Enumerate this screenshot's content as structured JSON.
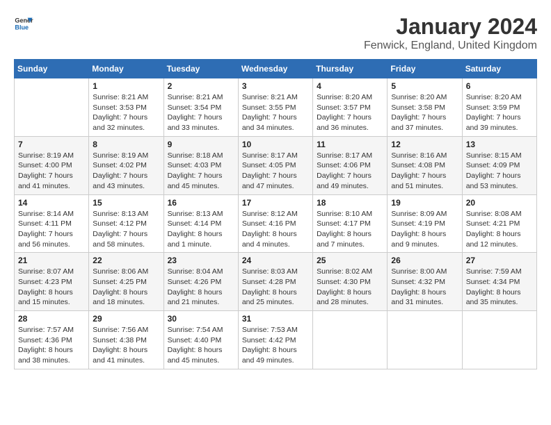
{
  "logo": {
    "line1": "General",
    "line2": "Blue"
  },
  "title": "January 2024",
  "subtitle": "Fenwick, England, United Kingdom",
  "weekdays": [
    "Sunday",
    "Monday",
    "Tuesday",
    "Wednesday",
    "Thursday",
    "Friday",
    "Saturday"
  ],
  "weeks": [
    [
      {
        "day": "",
        "info": ""
      },
      {
        "day": "1",
        "info": "Sunrise: 8:21 AM\nSunset: 3:53 PM\nDaylight: 7 hours\nand 32 minutes."
      },
      {
        "day": "2",
        "info": "Sunrise: 8:21 AM\nSunset: 3:54 PM\nDaylight: 7 hours\nand 33 minutes."
      },
      {
        "day": "3",
        "info": "Sunrise: 8:21 AM\nSunset: 3:55 PM\nDaylight: 7 hours\nand 34 minutes."
      },
      {
        "day": "4",
        "info": "Sunrise: 8:20 AM\nSunset: 3:57 PM\nDaylight: 7 hours\nand 36 minutes."
      },
      {
        "day": "5",
        "info": "Sunrise: 8:20 AM\nSunset: 3:58 PM\nDaylight: 7 hours\nand 37 minutes."
      },
      {
        "day": "6",
        "info": "Sunrise: 8:20 AM\nSunset: 3:59 PM\nDaylight: 7 hours\nand 39 minutes."
      }
    ],
    [
      {
        "day": "7",
        "info": ""
      },
      {
        "day": "8",
        "info": "Sunrise: 8:19 AM\nSunset: 4:02 PM\nDaylight: 7 hours\nand 43 minutes."
      },
      {
        "day": "9",
        "info": "Sunrise: 8:18 AM\nSunset: 4:03 PM\nDaylight: 7 hours\nand 45 minutes."
      },
      {
        "day": "10",
        "info": "Sunrise: 8:17 AM\nSunset: 4:05 PM\nDaylight: 7 hours\nand 47 minutes."
      },
      {
        "day": "11",
        "info": "Sunrise: 8:17 AM\nSunset: 4:06 PM\nDaylight: 7 hours\nand 49 minutes."
      },
      {
        "day": "12",
        "info": "Sunrise: 8:16 AM\nSunset: 4:08 PM\nDaylight: 7 hours\nand 51 minutes."
      },
      {
        "day": "13",
        "info": "Sunrise: 8:15 AM\nSunset: 4:09 PM\nDaylight: 7 hours\nand 53 minutes."
      }
    ],
    [
      {
        "day": "14",
        "info": ""
      },
      {
        "day": "15",
        "info": "Sunrise: 8:13 AM\nSunset: 4:12 PM\nDaylight: 7 hours\nand 58 minutes."
      },
      {
        "day": "16",
        "info": "Sunrise: 8:13 AM\nSunset: 4:14 PM\nDaylight: 8 hours\nand 1 minute."
      },
      {
        "day": "17",
        "info": "Sunrise: 8:12 AM\nSunset: 4:16 PM\nDaylight: 8 hours\nand 4 minutes."
      },
      {
        "day": "18",
        "info": "Sunrise: 8:10 AM\nSunset: 4:17 PM\nDaylight: 8 hours\nand 7 minutes."
      },
      {
        "day": "19",
        "info": "Sunrise: 8:09 AM\nSunset: 4:19 PM\nDaylight: 8 hours\nand 9 minutes."
      },
      {
        "day": "20",
        "info": "Sunrise: 8:08 AM\nSunset: 4:21 PM\nDaylight: 8 hours\nand 12 minutes."
      }
    ],
    [
      {
        "day": "21",
        "info": ""
      },
      {
        "day": "22",
        "info": "Sunrise: 8:06 AM\nSunset: 4:25 PM\nDaylight: 8 hours\nand 18 minutes."
      },
      {
        "day": "23",
        "info": "Sunrise: 8:04 AM\nSunset: 4:26 PM\nDaylight: 8 hours\nand 21 minutes."
      },
      {
        "day": "24",
        "info": "Sunrise: 8:03 AM\nSunset: 4:28 PM\nDaylight: 8 hours\nand 25 minutes."
      },
      {
        "day": "25",
        "info": "Sunrise: 8:02 AM\nSunset: 4:30 PM\nDaylight: 8 hours\nand 28 minutes."
      },
      {
        "day": "26",
        "info": "Sunrise: 8:00 AM\nSunset: 4:32 PM\nDaylight: 8 hours\nand 31 minutes."
      },
      {
        "day": "27",
        "info": "Sunrise: 7:59 AM\nSunset: 4:34 PM\nDaylight: 8 hours\nand 35 minutes."
      }
    ],
    [
      {
        "day": "28",
        "info": ""
      },
      {
        "day": "29",
        "info": "Sunrise: 7:56 AM\nSunset: 4:38 PM\nDaylight: 8 hours\nand 41 minutes."
      },
      {
        "day": "30",
        "info": "Sunrise: 7:54 AM\nSunset: 4:40 PM\nDaylight: 8 hours\nand 45 minutes."
      },
      {
        "day": "31",
        "info": "Sunrise: 7:53 AM\nSunset: 4:42 PM\nDaylight: 8 hours\nand 49 minutes."
      },
      {
        "day": "",
        "info": ""
      },
      {
        "day": "",
        "info": ""
      },
      {
        "day": "",
        "info": ""
      }
    ]
  ],
  "week1_sun_info": "Sunrise: 8:19 AM\nSunset: 4:00 PM\nDaylight: 7 hours\nand 41 minutes.",
  "week3_sun_info": "Sunrise: 8:14 AM\nSunset: 4:11 PM\nDaylight: 7 hours\nand 56 minutes.",
  "week4_sun_info": "Sunrise: 8:07 AM\nSunset: 4:23 PM\nDaylight: 8 hours\nand 15 minutes.",
  "week5_sun_info": "Sunrise: 7:57 AM\nSunset: 4:36 PM\nDaylight: 8 hours\nand 38 minutes."
}
